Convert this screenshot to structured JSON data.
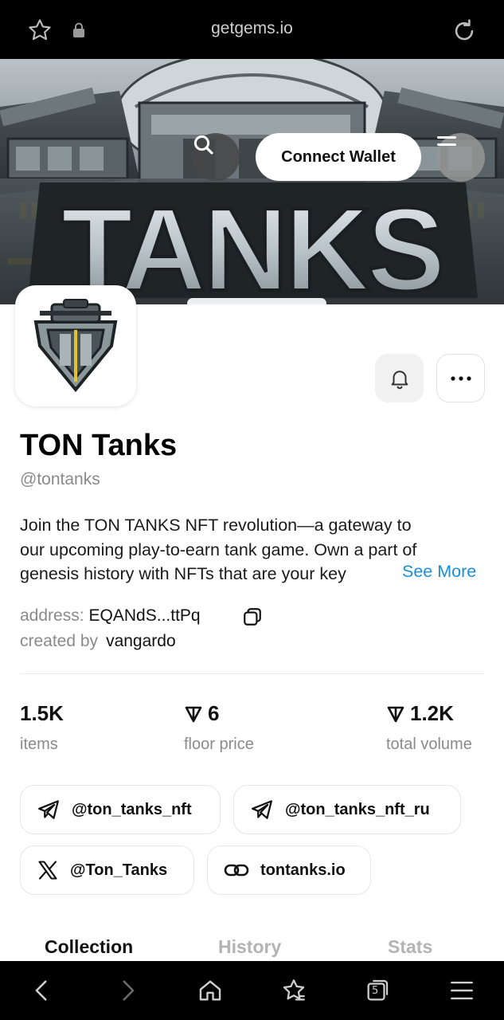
{
  "browser": {
    "url": "getgems.io"
  },
  "header": {
    "connect_wallet_label": "Connect Wallet"
  },
  "banner": {
    "text": "TANKS"
  },
  "collection": {
    "name": "TON Tanks",
    "handle": "@tontanks",
    "description_lines": [
      "Join the TON TANKS NFT revolution—a gateway to",
      "our upcoming play-to-earn tank game. Own a part of",
      "genesis history with NFTs that are your key"
    ],
    "see_more_label": "See More",
    "address_label": "address:",
    "address_value": "EQANdS...ttPq",
    "created_by_label": "created by",
    "creator": "vangardo"
  },
  "stats": {
    "items_value": "1.5K",
    "items_label": "items",
    "floor_value": "6",
    "floor_label": "floor price",
    "volume_value": "1.2K",
    "volume_label": "total volume"
  },
  "links": {
    "telegram_1": "@ton_tanks_nft",
    "telegram_2": "@ton_tanks_nft_ru",
    "x": "@Ton_Tanks",
    "website": "tontanks.io"
  },
  "tabs": {
    "collection": "Collection",
    "history": "History",
    "stats": "Stats"
  },
  "navbar": {
    "tab_count": "5"
  },
  "colors": {
    "accent_link": "#1a8fd8",
    "chrome_bg": "#000000"
  }
}
